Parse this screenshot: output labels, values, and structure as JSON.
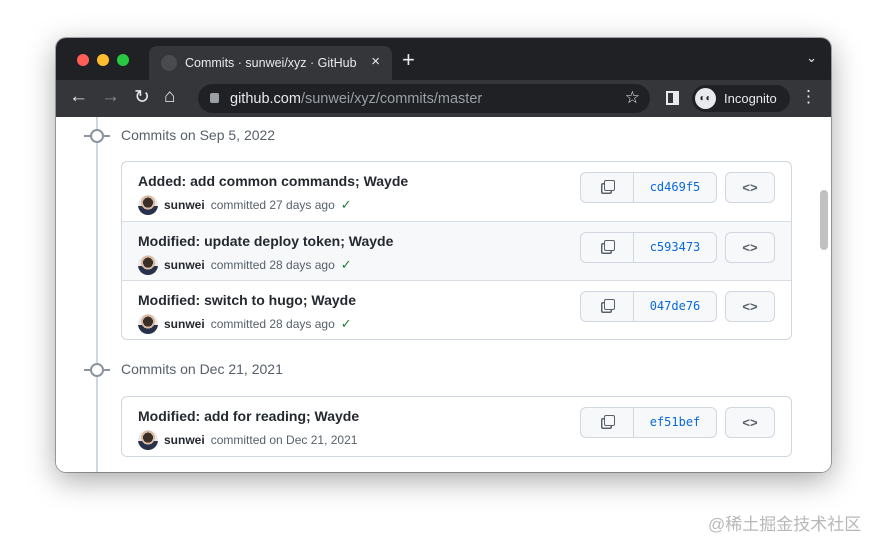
{
  "browser": {
    "tab_title": "Commits · sunwei/xyz · GitHub",
    "close_icon": "×",
    "new_tab_icon": "+",
    "tab_list_icon": "⌄",
    "url_host": "github.com",
    "url_path": "/sunwei/xyz/commits/master",
    "profile_label": "Incognito",
    "icons": {
      "back": "←",
      "forward": "→",
      "reload": "↻",
      "home": "⌂",
      "star": "☆",
      "menu": "⋮",
      "incognito": "◐◐"
    }
  },
  "groups": [
    {
      "header": "Commits on Sep 5, 2022",
      "commits": [
        {
          "title": "Added: add common commands; Wayde",
          "author": "sunwei",
          "when": "committed 27 days ago",
          "verified": true,
          "sha": "cd469f5"
        },
        {
          "title": "Modified: update deploy token; Wayde",
          "author": "sunwei",
          "when": "committed 28 days ago",
          "verified": true,
          "sha": "c593473"
        },
        {
          "title": "Modified: switch to hugo; Wayde",
          "author": "sunwei",
          "when": "committed 28 days ago",
          "verified": true,
          "sha": "047de76"
        }
      ]
    },
    {
      "header": "Commits on Dec 21, 2021",
      "commits": [
        {
          "title": "Modified: add for reading; Wayde",
          "author": "sunwei",
          "when": "committed on Dec 21, 2021",
          "verified": false,
          "sha": "ef51bef"
        }
      ]
    }
  ],
  "check_icon": "✓",
  "browse_icon": "<>",
  "watermark": "@稀土掘金技术社区"
}
